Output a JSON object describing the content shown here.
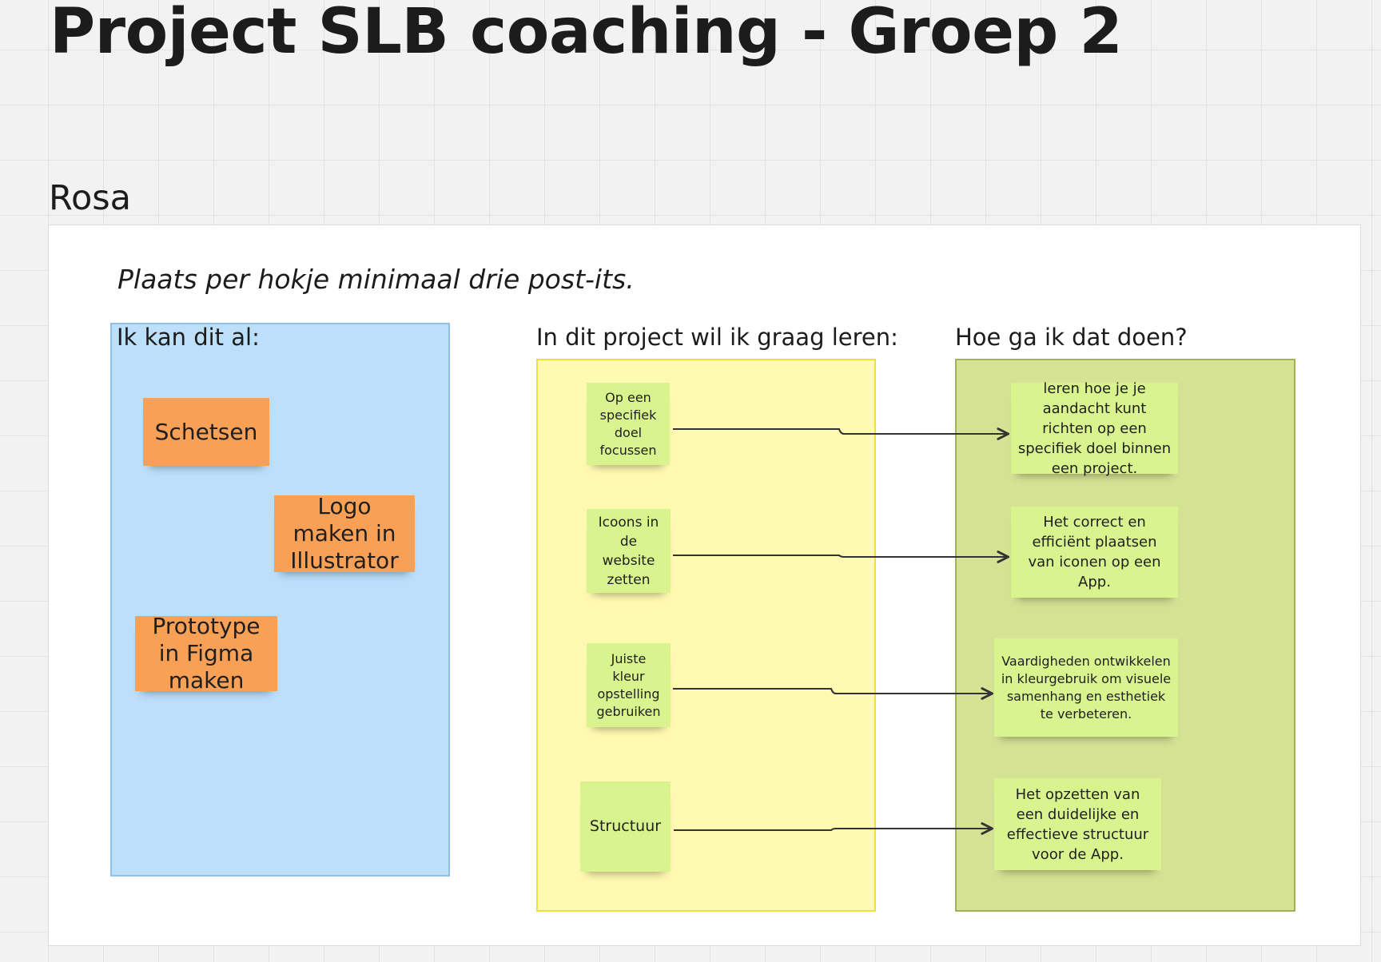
{
  "board": {
    "title": "Project SLB coaching - Groep 2",
    "person": "Rosa",
    "instruction": "Plaats per hokje minimaal drie post-its."
  },
  "columns": {
    "known": {
      "title": "Ik kan dit al:",
      "color": "#bcdffa",
      "notes": [
        "Schetsen",
        "Logo maken in Illustrator",
        "Prototype in Figma maken"
      ]
    },
    "learn": {
      "title": "In dit project wil ik graag leren:",
      "color": "#fff9b1",
      "notes": [
        "Op een specifiek doel focussen",
        "Icoons in de website zetten",
        "Juiste kleur opstelling gebruiken",
        "Structuur"
      ]
    },
    "how": {
      "title": "Hoe ga ik dat doen?",
      "color": "#d5e294",
      "notes": [
        "leren hoe je je aandacht kunt richten op een specifiek doel binnen een project.",
        "Het correct en efficiënt plaatsen van iconen op een App.",
        "Vaardigheden ontwikkelen in kleurgebruik om visuele samenhang en esthetiek te verbeteren.",
        "Het opzetten van een duidelijke en effectieve structuur voor de App."
      ]
    }
  },
  "colors": {
    "orange_note": "#f8a156",
    "green_note": "#d9f48e",
    "connector": "#333333"
  }
}
